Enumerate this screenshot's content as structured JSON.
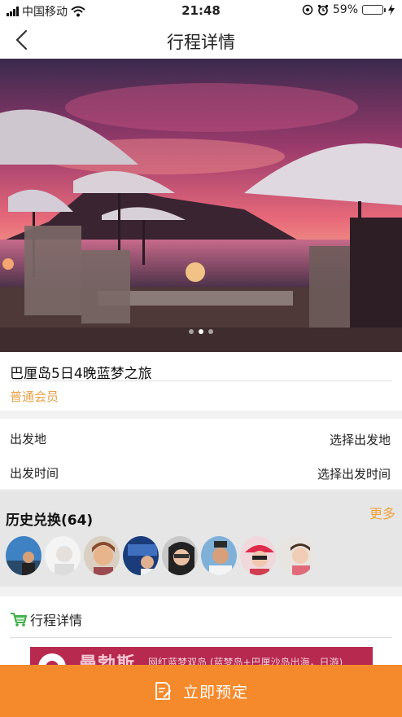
{
  "status": {
    "carrier": "中国移动",
    "time": "21:48",
    "battery": "59%",
    "battery_level": 0.59
  },
  "nav": {
    "title": "行程详情",
    "back_icon": "chevron-left-icon"
  },
  "hero": {
    "slide_count": 3,
    "active_slide": 1
  },
  "trip": {
    "name": "巴厘岛5日4晚蓝梦之旅",
    "member_level": "普通会员"
  },
  "departure": {
    "place_label": "出发地",
    "place_value": "选择出发地",
    "time_label": "出发时间",
    "time_value": "选择出发时间"
  },
  "history": {
    "title": "历史兑换(64)",
    "more": "更多",
    "avatar_count": 8
  },
  "details": {
    "title": "行程详情",
    "banner_title": "曼勃斯",
    "banner_sub": "网红蓝梦双岛 (蓝梦岛+巴厘沙岛出海，日游)"
  },
  "bottom": {
    "book_label": "立即预定"
  },
  "colors": {
    "accent": "#f58a2c",
    "member": "#e8a24a",
    "more": "#f0a23a"
  }
}
